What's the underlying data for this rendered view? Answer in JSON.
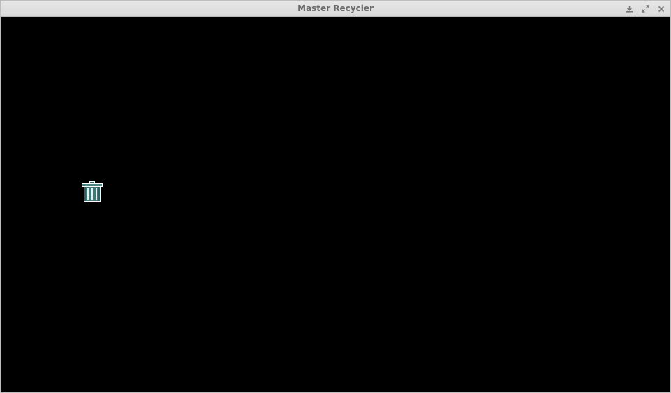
{
  "window": {
    "title": "Master Recycler",
    "controls": {
      "minimize_icon": "download-arrow-icon",
      "maximize_icon": "expand-arrows-icon",
      "close_icon": "close-x-icon"
    }
  },
  "game": {
    "background_color": "#000000",
    "sprite": {
      "icon": "trash-can-icon",
      "body_color": "#3f7a78",
      "outline_color": "#ffffff"
    }
  }
}
